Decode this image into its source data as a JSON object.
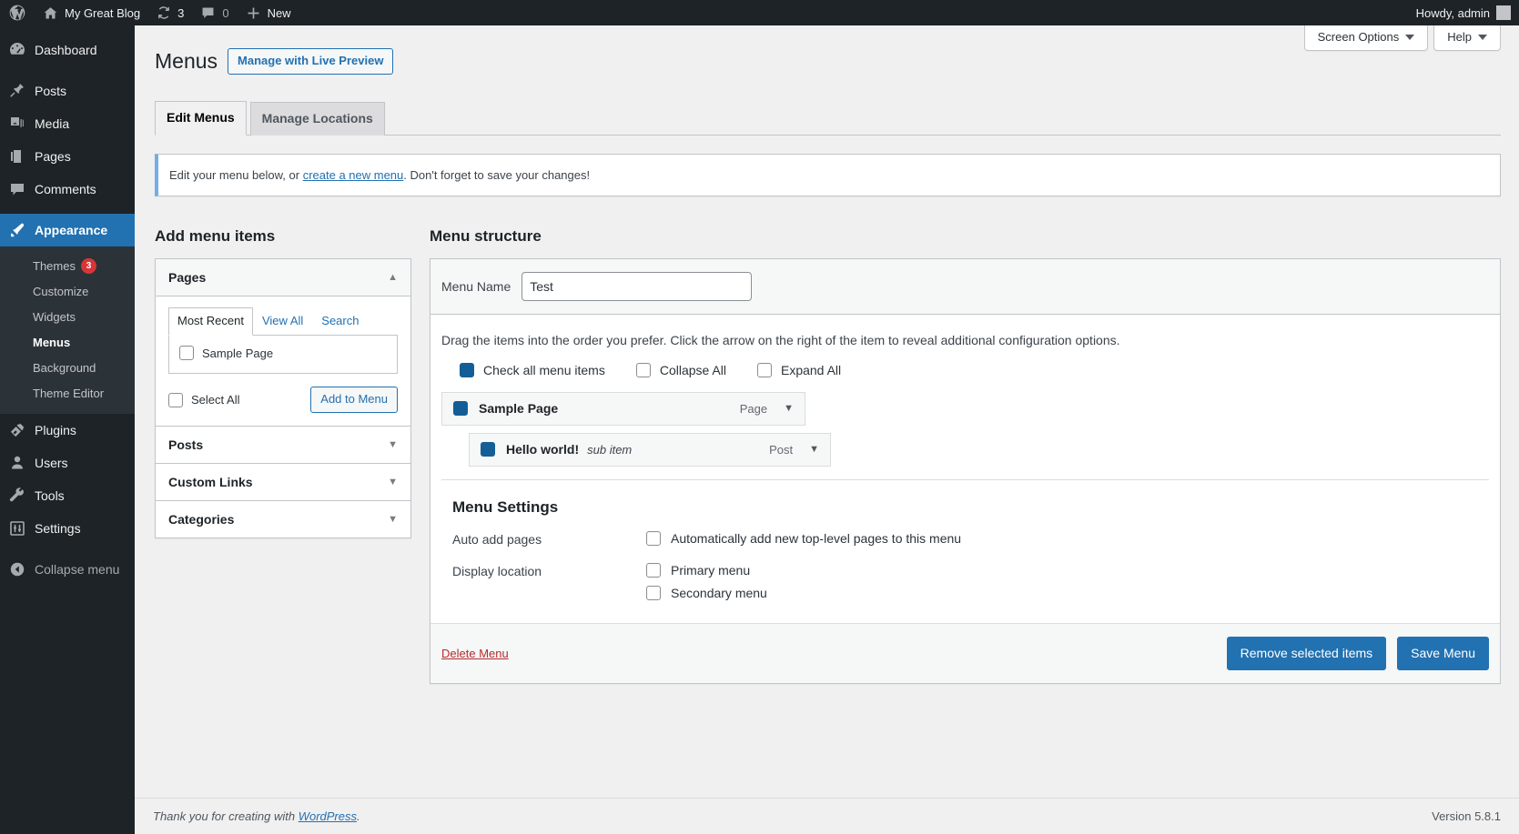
{
  "adminbar": {
    "logo_icon": "wordpress-logo-icon",
    "site_name": "My Great Blog",
    "site_icon": "home-icon",
    "updates_icon": "updates-icon",
    "updates_count": "3",
    "comments_icon": "comment-bubble-icon",
    "comments_count": "0",
    "new_icon": "plus-icon",
    "new_label": "New",
    "howdy": "Howdy, admin",
    "avatar_icon": "avatar-icon"
  },
  "sidebar": {
    "items": [
      {
        "label": "Dashboard",
        "icon": "dashboard-icon"
      },
      {
        "label": "Posts",
        "icon": "pin-icon"
      },
      {
        "label": "Media",
        "icon": "media-icon"
      },
      {
        "label": "Pages",
        "icon": "pages-icon"
      },
      {
        "label": "Comments",
        "icon": "comment-icon"
      },
      {
        "label": "Appearance",
        "icon": "appearance-brush-icon"
      },
      {
        "label": "Plugins",
        "icon": "plugins-icon"
      },
      {
        "label": "Users",
        "icon": "users-icon"
      },
      {
        "label": "Tools",
        "icon": "tools-wrench-icon"
      },
      {
        "label": "Settings",
        "icon": "settings-sliders-icon"
      }
    ],
    "appearance_submenu": [
      {
        "label": "Themes",
        "badge": "3"
      },
      {
        "label": "Customize",
        "badge": ""
      },
      {
        "label": "Widgets",
        "badge": ""
      },
      {
        "label": "Menus",
        "badge": ""
      },
      {
        "label": "Background",
        "badge": ""
      },
      {
        "label": "Theme Editor",
        "badge": ""
      }
    ],
    "collapse_label": "Collapse menu",
    "collapse_icon": "collapse-arrow-icon",
    "highlight_color": "#2271b1"
  },
  "screen_meta": {
    "screen_options": "Screen Options",
    "help": "Help"
  },
  "header": {
    "title": "Menus",
    "live_preview_button": "Manage with Live Preview",
    "tabs": [
      {
        "label": "Edit Menus",
        "active": true
      },
      {
        "label": "Manage Locations",
        "active": false
      }
    ]
  },
  "notice": {
    "text_before": "Edit your menu below, or ",
    "link": "create a new menu",
    "text_after": ". Don't forget to save your changes!"
  },
  "add_menu_items": {
    "heading": "Add menu items",
    "sections": [
      {
        "label": "Pages",
        "open": true,
        "toggle_icon": "chevron-up-icon"
      },
      {
        "label": "Posts",
        "open": false,
        "toggle_icon": "chevron-down-icon"
      },
      {
        "label": "Custom Links",
        "open": false,
        "toggle_icon": "chevron-down-icon"
      },
      {
        "label": "Categories",
        "open": false,
        "toggle_icon": "chevron-down-icon"
      }
    ],
    "pages_tabs": [
      {
        "label": "Most Recent",
        "active": true
      },
      {
        "label": "View All",
        "active": false
      },
      {
        "label": "Search",
        "active": false
      }
    ],
    "page_items": [
      {
        "label": "Sample Page",
        "checked": false
      }
    ],
    "select_all_label": "Select All",
    "select_all_checked": false,
    "add_to_menu_button": "Add to Menu"
  },
  "menu_structure": {
    "heading": "Menu structure",
    "menu_name_label": "Menu Name",
    "menu_name_value": "Test",
    "menu_name_placeholder": "Menu Name",
    "drag_hint": "Drag the items into the order you prefer. Click the arrow on the right of the item to reveal additional configuration options.",
    "bulk_controls": [
      {
        "label": "Check all menu items",
        "checked": true
      },
      {
        "label": "Collapse All",
        "checked": false
      },
      {
        "label": "Expand All",
        "checked": false
      }
    ],
    "items": [
      {
        "title": "Sample Page",
        "sub_label": "",
        "type": "Page",
        "checked": true,
        "child": false,
        "caret_icon": "chevron-down-icon"
      },
      {
        "title": "Hello world!",
        "sub_label": "sub item",
        "type": "Post",
        "checked": true,
        "child": true,
        "caret_icon": "chevron-down-icon"
      }
    ]
  },
  "menu_settings": {
    "heading": "Menu Settings",
    "auto_add_label": "Auto add pages",
    "auto_add_checkbox": {
      "label": "Automatically add new top-level pages to this menu",
      "checked": false
    },
    "display_location_label": "Display location",
    "locations": [
      {
        "label": "Primary menu",
        "checked": false
      },
      {
        "label": "Secondary menu",
        "checked": false
      }
    ]
  },
  "actions": {
    "delete_menu": "Delete Menu",
    "remove_selected": "Remove selected items",
    "save_menu": "Save Menu"
  },
  "footer": {
    "thanks_before": "Thank you for creating with ",
    "thanks_link": "WordPress",
    "thanks_after": ".",
    "version": "Version 5.8.1"
  },
  "colors": {
    "accent": "#2271b1",
    "dark": "#1d2327",
    "checkbox_checked": "#135e96",
    "danger": "#b32d2e",
    "badge": "#d63638"
  }
}
